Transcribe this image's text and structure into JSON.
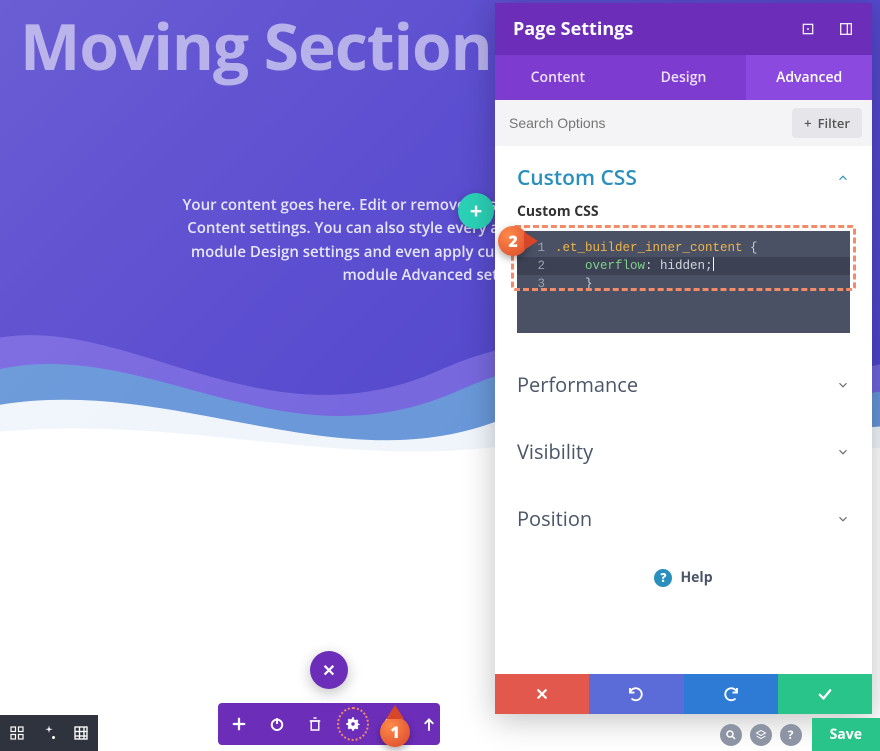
{
  "hero": {
    "title": "Moving Section Divider",
    "body": "Your content goes here. Edit or remove this text inline or in the module Content settings. You can also style every aspect of this content in the module Design settings and even apply custom CSS to this text in the module Advanced settings."
  },
  "panel": {
    "title": "Page Settings",
    "tabs": {
      "content": "Content",
      "design": "Design",
      "advanced": "Advanced"
    },
    "search_placeholder": "Search Options",
    "filter_label": "Filter",
    "sections": {
      "custom_css": {
        "title": "Custom CSS",
        "label": "Custom CSS"
      },
      "performance": "Performance",
      "visibility": "Visibility",
      "position": "Position"
    },
    "code": {
      "line1_selector": ".et_builder_inner_content",
      "line1_brace": " {",
      "line2_prop": "overflow",
      "line2_colon": ": ",
      "line2_val": "hidden",
      "line2_semi": ";",
      "line3": "}"
    },
    "help": "Help",
    "save": "Save"
  },
  "annotations": {
    "badge1": "1",
    "badge2": "2"
  }
}
